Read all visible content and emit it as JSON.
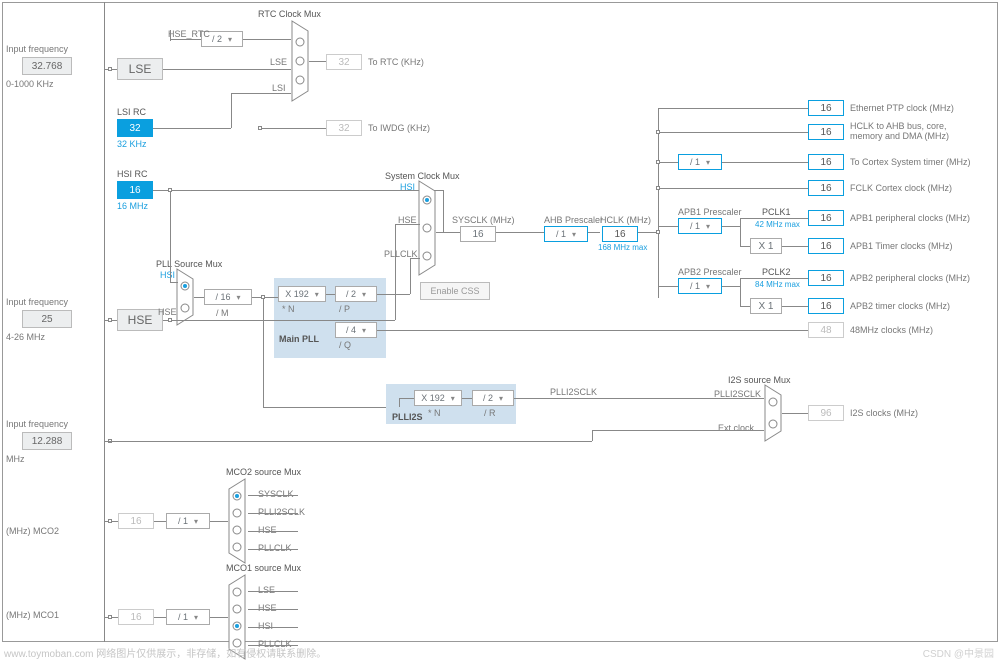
{
  "side": {
    "freq1_label": "Input frequency",
    "freq1_val": "32.768",
    "freq1_note": "0-1000 KHz",
    "freq2_label": "Input frequency",
    "freq2_val": "25",
    "freq2_note": "4-26 MHz",
    "freq3_label": "Input frequency",
    "freq3_val": "12.288",
    "freq3_note": "MHz",
    "mco2_label": "(MHz) MCO2",
    "mco2_val": "16",
    "mco2_div": "/ 1",
    "mco1_label": "(MHz) MCO1",
    "mco1_val": "16",
    "mco1_div": "/ 1"
  },
  "sources": {
    "lse_label": "LSE",
    "lsi_label": "LSI RC",
    "lsi_val": "32",
    "lsi_note": "32 KHz",
    "hsi_label": "HSI RC",
    "hsi_val": "16",
    "hsi_note": "16 MHz",
    "hse_label": "HSE"
  },
  "rtc": {
    "title": "RTC Clock Mux",
    "div": "/ 2",
    "hse_rtc": "HSE_RTC",
    "lse": "LSE",
    "lsi": "LSI",
    "out_val": "32",
    "out_label": "To RTC (KHz)",
    "iwdg_val": "32",
    "iwdg_label": "To IWDG (KHz)"
  },
  "pllsrc": {
    "title": "PLL Source Mux",
    "hsi": "HSI",
    "hse": "HSE",
    "div": "/ 16",
    "divnote": "/ M"
  },
  "mainpll": {
    "title": "Main PLL",
    "n_val": "X 192",
    "n_note": "* N",
    "p_val": "/ 2",
    "p_note": "/ P",
    "q_val": "/ 4",
    "q_note": "/ Q"
  },
  "plli2s": {
    "title": "PLLI2S",
    "n_val": "X 192",
    "n_note": "* N",
    "r_val": "/ 2",
    "r_note": "/ R",
    "out": "PLLI2SCLK"
  },
  "sysclk": {
    "title": "System Clock Mux",
    "hsi": "HSI",
    "hse": "HSE",
    "pllclk": "PLLCLK",
    "css": "Enable CSS",
    "sysclk_label": "SYSCLK (MHz)",
    "sysclk_val": "16",
    "ahb_label": "AHB Prescaler",
    "ahb_val": "/ 1",
    "hclk_label": "HCLK (MHz)",
    "hclk_val": "16",
    "hclk_note": "168 MHz max"
  },
  "apb": {
    "apb1_label": "APB1 Prescaler",
    "apb1_val": "/ 1",
    "pclk1_label": "PCLK1",
    "pclk1_note": "42 MHz max",
    "apb1_timer": "X 1",
    "apb2_label": "APB2 Prescaler",
    "apb2_val": "/ 1",
    "pclk2_label": "PCLK2",
    "pclk2_note": "84 MHz max",
    "apb2_timer": "X 1",
    "cortex_div": "/ 1"
  },
  "outputs": {
    "eth_val": "16",
    "eth_label": "Ethernet PTP clock (MHz)",
    "hclk_val": "16",
    "hclk_label": "HCLK to AHB bus, core, memory and DMA (MHz)",
    "cortex_val": "16",
    "cortex_label": "To Cortex System timer (MHz)",
    "fclk_val": "16",
    "fclk_label": "FCLK Cortex clock (MHz)",
    "apb1p_val": "16",
    "apb1p_label": "APB1 peripheral clocks (MHz)",
    "apb1t_val": "16",
    "apb1t_label": "APB1 Timer clocks (MHz)",
    "apb2p_val": "16",
    "apb2p_label": "APB2 peripheral clocks (MHz)",
    "apb2t_val": "16",
    "apb2t_label": "APB2 timer clocks (MHz)",
    "mhz48_val": "48",
    "mhz48_label": "48MHz clocks (MHz)",
    "i2s_val": "96",
    "i2s_label": "I2S clocks (MHz)"
  },
  "i2smux": {
    "title": "I2S source Mux",
    "in1": "PLLI2SCLK",
    "in2": "Ext clock"
  },
  "mco2mux": {
    "title": "MCO2 source Mux",
    "a": "SYSCLK",
    "b": "PLLI2SCLK",
    "c": "HSE",
    "d": "PLLCLK"
  },
  "mco1mux": {
    "title": "MCO1 source Mux",
    "a": "LSE",
    "b": "HSE",
    "c": "HSI",
    "d": "PLLCLK"
  },
  "footer": "www.toymoban.com 网络图片仅供展示，非存储，如有侵权请联系删除。",
  "watermark": "CSDN @中景园"
}
